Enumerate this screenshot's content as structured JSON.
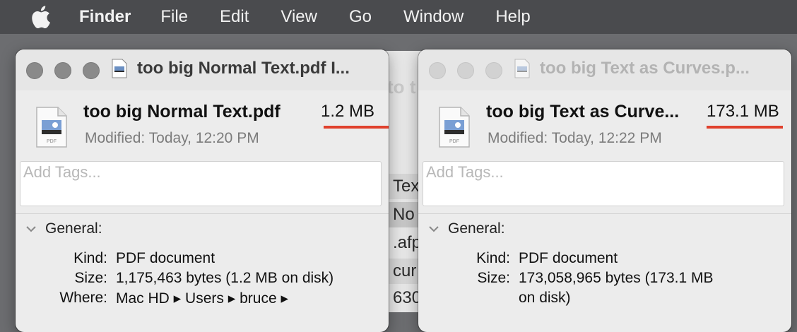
{
  "menubar": {
    "icon": "apple-icon",
    "app": "Finder",
    "items": [
      "File",
      "Edit",
      "View",
      "Go",
      "Window",
      "Help"
    ]
  },
  "background_window": {
    "title_fragment": "to t",
    "rows": [
      "Tex",
      "No",
      ".afp",
      "cur",
      "630"
    ]
  },
  "windows": [
    {
      "state": "active",
      "title": "too big Normal Text.pdf I...",
      "file_name": "too big Normal Text.pdf",
      "size": "1.2 MB",
      "modified": "Modified: Today, 12:20 PM",
      "tags_placeholder": "Add Tags...",
      "section": "General:",
      "kind_label": "Kind:",
      "kind": "PDF document",
      "size_label": "Size:",
      "size_detail": "1,175,463 bytes (1.2 MB on disk)",
      "where_label": "Where:",
      "where": "Mac HD ▸ Users ▸ bruce ▸"
    },
    {
      "state": "inactive",
      "title": "too big Text as Curves.p...",
      "file_name": "too big Text as Curve...",
      "size": "173.1 MB",
      "modified": "Modified: Today, 12:22 PM",
      "tags_placeholder": "Add Tags...",
      "section": "General:",
      "kind_label": "Kind:",
      "kind": "PDF document",
      "size_label": "Size:",
      "size_detail_line1": "173,058,965 bytes (173.1 MB",
      "size_detail_line2": "on disk)"
    }
  ],
  "colors": {
    "highlight_underline": "#e0412d"
  },
  "icons": [
    "apple-icon",
    "pdf-file-icon",
    "chevron-down-icon"
  ]
}
